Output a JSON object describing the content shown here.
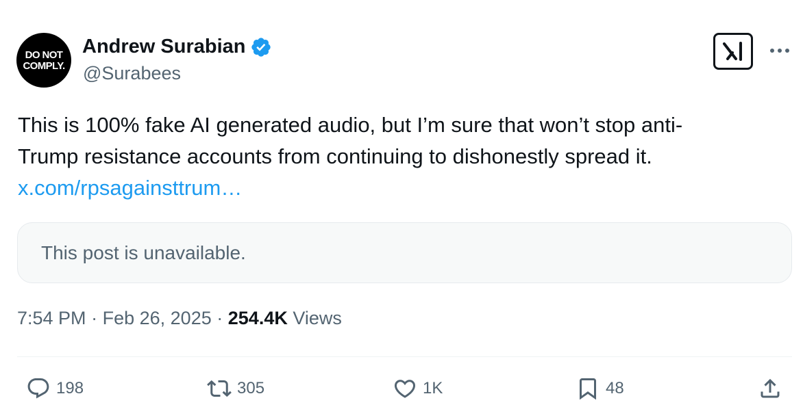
{
  "author": {
    "avatar_text_line1": "DO NOT",
    "avatar_text_line2": "COMPLY.",
    "display_name": "Andrew Surabian",
    "handle": "@Surabees",
    "verified_icon": "verified-badge-icon"
  },
  "header_actions": {
    "grok_icon": "grok-icon",
    "more_icon": "more-icon"
  },
  "tweet": {
    "text_line1": "This is 100% fake AI generated audio, but I’m sure that won’t stop anti-",
    "text_line2": "Trump resistance accounts from continuing to dishonestly spread it.",
    "link": "x.com/rpsagainsttrum…"
  },
  "quoted_post": {
    "message": "This post is unavailable."
  },
  "meta": {
    "time": "7:54 PM",
    "separator": "·",
    "date": "Feb 26, 2025",
    "views_count": "254.4K",
    "views_label": "Views"
  },
  "actions": {
    "replies": "198",
    "reposts": "305",
    "likes": "1K",
    "bookmarks": "48"
  },
  "colors": {
    "accent": "#1d9bf0",
    "text_primary": "#0f1419",
    "text_secondary": "#536471",
    "card_bg": "#f7f9f9"
  }
}
